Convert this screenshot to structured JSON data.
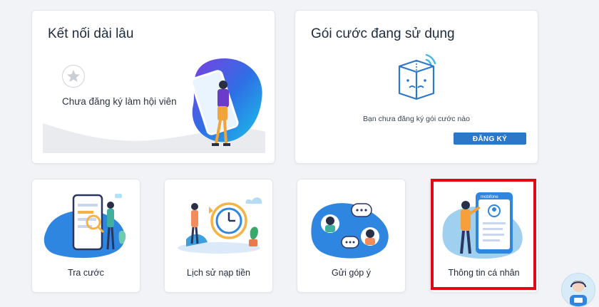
{
  "membership_card": {
    "title": "Kết nối dài lâu",
    "status_text": "Chưa đăng ký làm hội viên"
  },
  "package_card": {
    "title": "Gói cước đang sử dụng",
    "empty_text": "Bạn chưa đăng ký gói cước nào",
    "register_label": "ĐĂNG KÝ"
  },
  "tiles": [
    {
      "label": "Tra cước",
      "icon": "phone-search-icon"
    },
    {
      "label": "Lịch sử nạp tiền",
      "icon": "clock-history-icon"
    },
    {
      "label": "Gửi góp ý",
      "icon": "chat-feedback-icon"
    },
    {
      "label": "Thông tin cá nhân",
      "icon": "profile-card-icon",
      "highlighted": true
    }
  ],
  "brand_text": "mobifone",
  "colors": {
    "accent": "#2d77c9",
    "highlight_border": "#e10914",
    "illustration_blue": "#1e8fe0",
    "illustration_purple": "#6a3fd1"
  }
}
